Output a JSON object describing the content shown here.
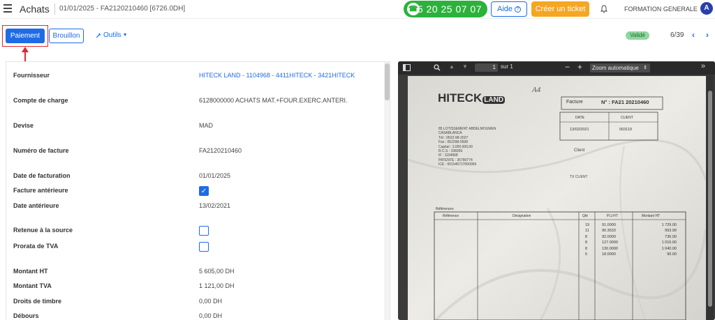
{
  "header": {
    "menu_icon": "hamburger-icon",
    "title": "Achats",
    "doc_ref": "01/01/2025 - FA2120210460 [6726.0DH]",
    "phone": "05 20 25 07 07",
    "help_label": "Aide",
    "ticket_label": "Créer un ticket",
    "company": "FORMATION GENERALE",
    "avatar_initial": "A"
  },
  "toolbar": {
    "paiement_label": "Paiement",
    "brouillon_label": "Brouillon",
    "outils_label": "Outils",
    "status_badge": "Validé",
    "pager": "6/39"
  },
  "form": {
    "fournisseur": {
      "label": "Fournisseur",
      "value": "HITECK LAND - 1104968 - 4411HITECK - 3421HITECK"
    },
    "compte_charge": {
      "label": "Compte de charge",
      "value": "6128000000 ACHATS MAT.+FOUR.EXERC.ANTERI."
    },
    "devise": {
      "label": "Devise",
      "value": "MAD"
    },
    "numero_facture": {
      "label": "Numéro de facture",
      "value": "FA2120210460"
    },
    "date_facturation": {
      "label": "Date de facturation",
      "value": "01/01/2025"
    },
    "facture_anterieure": {
      "label": "Facture antérieure",
      "checked": true
    },
    "date_anterieure": {
      "label": "Date antérieure",
      "value": "13/02/2021"
    },
    "retenue_source": {
      "label": "Retenue à la source",
      "checked": false
    },
    "prorata_tva": {
      "label": "Prorata de TVA",
      "checked": false
    },
    "montant_ht": {
      "label": "Montant HT",
      "value": "5 605,00 DH"
    },
    "montant_tva": {
      "label": "Montant TVA",
      "value": "1 121,00 DH"
    },
    "droits_timbre": {
      "label": "Droits de timbre",
      "value": "0,00 DH"
    },
    "debours": {
      "label": "Débours",
      "value": "0,00 DH"
    }
  },
  "pdf": {
    "page_number": "1",
    "page_total": "sur 1",
    "zoom": "Zoom automatique",
    "scan": {
      "brand": "HITECK",
      "brand_suffix": "LAND",
      "handwritten_code": "A4",
      "facture_label": "Facture",
      "facture_number": "N° : FA21 20210460",
      "date_header": "DATE",
      "client_header": "CLIENT",
      "date_value": "13/02/2021",
      "client_value": "003119",
      "address_lines": [
        "85 LOTISSEMENT ABDELMOUMEN",
        "CASABLANCA",
        "Tél : 0522-98-2027",
        "Fax : 052298-0598",
        "Capital : 3.000.000,00",
        "R.C.S : 198359",
        "IF : 1104968",
        "PATENTE : 35780774",
        "ICE : 001545727000069"
      ],
      "client_label": "Client",
      "tx_client": "TX CLIENT",
      "references_label": "Références",
      "table_headers": [
        "Référence",
        "Désignation",
        "Qté",
        "P.U.HT",
        "Montant HT"
      ],
      "qty": [
        "19",
        "11",
        "8",
        "8",
        "8",
        "5"
      ],
      "unit_prices": [
        "91.0000",
        "90.3633",
        "92.0000",
        "127.0000",
        "130.0000",
        "18.0000"
      ],
      "amounts": [
        "1 729.00",
        "993.99",
        "736.00",
        "1 016.00",
        "1 040.00",
        "90.00"
      ]
    }
  }
}
